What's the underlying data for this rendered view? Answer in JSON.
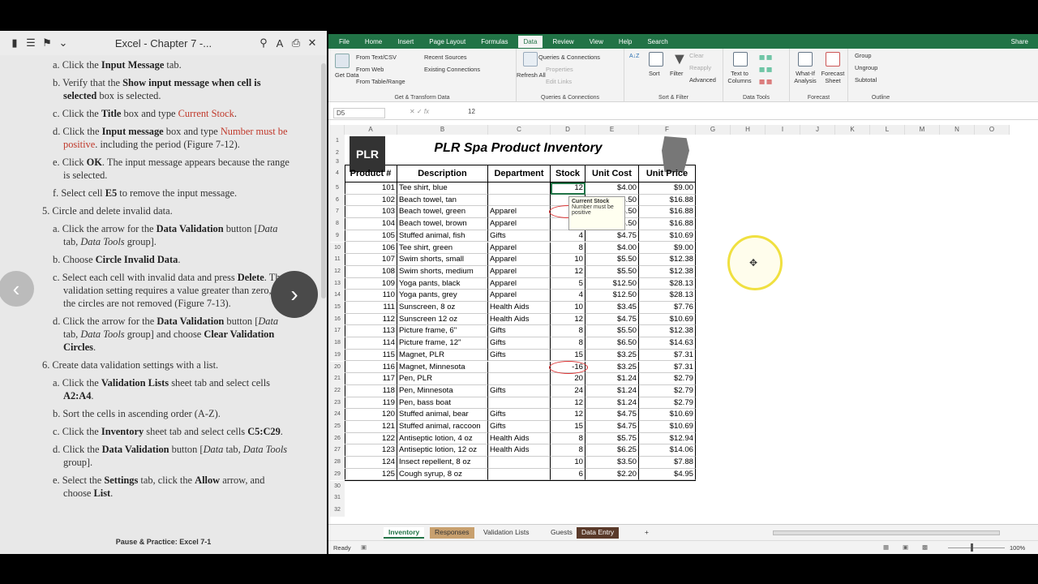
{
  "reader": {
    "title": "Excel - Chapter 7 -...",
    "footer": "Pause & Practice: Excel 7-1",
    "lines": [
      {
        "cls": "ind",
        "html": "a. Click the <b>Input Message</b> tab."
      },
      {
        "cls": "ind",
        "html": "b. Verify that the <b>Show input message when cell is selected</b> box is selected."
      },
      {
        "cls": "ind",
        "html": "c. Click the <b>Title</b> box and type <span class='red'>Current Stock</span>."
      },
      {
        "cls": "ind",
        "html": "d. Click the <b>Input message</b> box and type <span class='red'>Number must be positive</span>. including the period (Figure 7-12)."
      },
      {
        "cls": "ind",
        "html": "e. Click <b>OK</b>. The input message appears because the range is selected."
      },
      {
        "cls": "ind",
        "html": "f. Select cell <b>E5</b> to remove the input message."
      },
      {
        "cls": "top",
        "html": "5. Circle and delete invalid data."
      },
      {
        "cls": "ind",
        "html": "a. Click the arrow for the <b>Data Validation</b> button [<i>Data</i> tab, <i>Data Tools</i> group]."
      },
      {
        "cls": "ind",
        "html": "b. Choose <b>Circle Invalid Data</b>."
      },
      {
        "cls": "ind",
        "html": "c. Select each cell with invalid data and press <b>Delete</b>. The validation setting requires a value greater than zero, so the circles are not removed (Figure 7-13)."
      },
      {
        "cls": "ind",
        "html": "d. Click the arrow for the <b>Data Validation</b> button [<i>Data</i> tab, <i>Data Tools</i> group] and choose <b>Clear Validation Circles</b>."
      },
      {
        "cls": "top",
        "html": "6. Create data validation settings with a list."
      },
      {
        "cls": "ind",
        "html": "a. Click the <b>Validation Lists</b> sheet tab and select cells <b>A2:A4</b>."
      },
      {
        "cls": "ind",
        "html": "b. Sort the cells in ascending order (A-Z)."
      },
      {
        "cls": "ind",
        "html": "c. Click the <b>Inventory</b> sheet tab and select cells <b>C5:C29</b>."
      },
      {
        "cls": "ind",
        "html": "d. Click the <b>Data Validation</b> button [<i>Data</i> tab, <i>Data Tools</i> group]."
      },
      {
        "cls": "ind",
        "html": "e. Select the <b>Settings</b> tab, click the <b>Allow</b> arrow, and choose <b>List</b>."
      }
    ]
  },
  "excel": {
    "tabs": [
      "File",
      "Home",
      "Insert",
      "Page Layout",
      "Formulas",
      "Data",
      "Review",
      "View",
      "Help",
      "Search"
    ],
    "share": "Share",
    "ribbon": {
      "get_data": "Get Data",
      "from_text": "From Text/CSV",
      "from_web": "From Web",
      "from_table": "From Table/Range",
      "recent": "Recent Sources",
      "existing": "Existing Connections",
      "g1": "Get & Transform Data",
      "refresh": "Refresh All",
      "queries": "Queries & Connections",
      "properties": "Properties",
      "edit_links": "Edit Links",
      "g2": "Queries & Connections",
      "sort": "Sort",
      "filter": "Filter",
      "clear": "Clear",
      "reapply": "Reapply",
      "advanced": "Advanced",
      "g3": "Sort & Filter",
      "ttc": "Text to Columns",
      "g4": "Data Tools",
      "whatif": "What-If Analysis",
      "forecast": "Forecast Sheet",
      "g5": "Forecast",
      "group": "Group",
      "ungroup": "Ungroup",
      "subtotal": "Subtotal",
      "g6": "Outline"
    },
    "namebox": "D5",
    "formula": "12",
    "columns": [
      "A",
      "B",
      "C",
      "D",
      "E",
      "F",
      "G",
      "H",
      "I",
      "J",
      "K",
      "L",
      "M",
      "N",
      "O"
    ],
    "title": "PLR Spa Product Inventory",
    "logo_text": "PLR",
    "headers": [
      "Product #",
      "Description",
      "Department",
      "Stock",
      "Unit Cost",
      "Unit Price"
    ],
    "rows": [
      [
        "101",
        "Tee shirt, blue",
        "",
        "12",
        "$4.00",
        "$9.00"
      ],
      [
        "102",
        "Beach towel, tan",
        "",
        "",
        "$5.50",
        "$16.88"
      ],
      [
        "103",
        "Beach towel, green",
        "Apparel",
        "",
        "$5.50",
        "$16.88"
      ],
      [
        "104",
        "Beach towel, brown",
        "Apparel",
        "",
        "$5.50",
        "$16.88"
      ],
      [
        "105",
        "Stuffed animal, fish",
        "Gifts",
        "4",
        "$4.75",
        "$10.69"
      ],
      [
        "106",
        "Tee shirt, green",
        "Apparel",
        "8",
        "$4.00",
        "$9.00"
      ],
      [
        "107",
        "Swim shorts, small",
        "Apparel",
        "10",
        "$5.50",
        "$12.38"
      ],
      [
        "108",
        "Swim shorts, medium",
        "Apparel",
        "12",
        "$5.50",
        "$12.38"
      ],
      [
        "109",
        "Yoga pants, black",
        "Apparel",
        "5",
        "$12.50",
        "$28.13"
      ],
      [
        "110",
        "Yoga pants, grey",
        "Apparel",
        "4",
        "$12.50",
        "$28.13"
      ],
      [
        "111",
        "Sunscreen, 8 oz",
        "Health Aids",
        "10",
        "$3.45",
        "$7.76"
      ],
      [
        "112",
        "Sunscreen 12 oz",
        "Health Aids",
        "12",
        "$4.75",
        "$10.69"
      ],
      [
        "113",
        "Picture frame, 6\"",
        "Gifts",
        "8",
        "$5.50",
        "$12.38"
      ],
      [
        "114",
        "Picture frame, 12\"",
        "Gifts",
        "8",
        "$6.50",
        "$14.63"
      ],
      [
        "115",
        "Magnet, PLR",
        "Gifts",
        "15",
        "$3.25",
        "$7.31"
      ],
      [
        "116",
        "Magnet, Minnesota",
        "",
        "-16",
        "$3.25",
        "$7.31"
      ],
      [
        "117",
        "Pen, PLR",
        "",
        "20",
        "$1.24",
        "$2.79"
      ],
      [
        "118",
        "Pen, Minnesota",
        "Gifts",
        "24",
        "$1.24",
        "$2.79"
      ],
      [
        "119",
        "Pen, bass boat",
        "",
        "12",
        "$1.24",
        "$2.79"
      ],
      [
        "120",
        "Stuffed animal, bear",
        "Gifts",
        "12",
        "$4.75",
        "$10.69"
      ],
      [
        "121",
        "Stuffed animal, raccoon",
        "Gifts",
        "15",
        "$4.75",
        "$10.69"
      ],
      [
        "122",
        "Antiseptic lotion, 4 oz",
        "Health Aids",
        "8",
        "$5.75",
        "$12.94"
      ],
      [
        "123",
        "Antiseptic lotion, 12 oz",
        "Health Aids",
        "8",
        "$6.25",
        "$14.06"
      ],
      [
        "124",
        "Insect repellent, 8 oz",
        "",
        "10",
        "$3.50",
        "$7.88"
      ],
      [
        "125",
        "Cough syrup, 8 oz",
        "",
        "6",
        "$2.20",
        "$4.95"
      ]
    ],
    "tooltip": {
      "title": "Current Stock",
      "body": "Number must be positive"
    },
    "sheets": [
      "Inventory",
      "Responses",
      "Validation Lists",
      "Guests",
      "Data Entry"
    ],
    "status": "Ready",
    "zoom": "100%"
  }
}
